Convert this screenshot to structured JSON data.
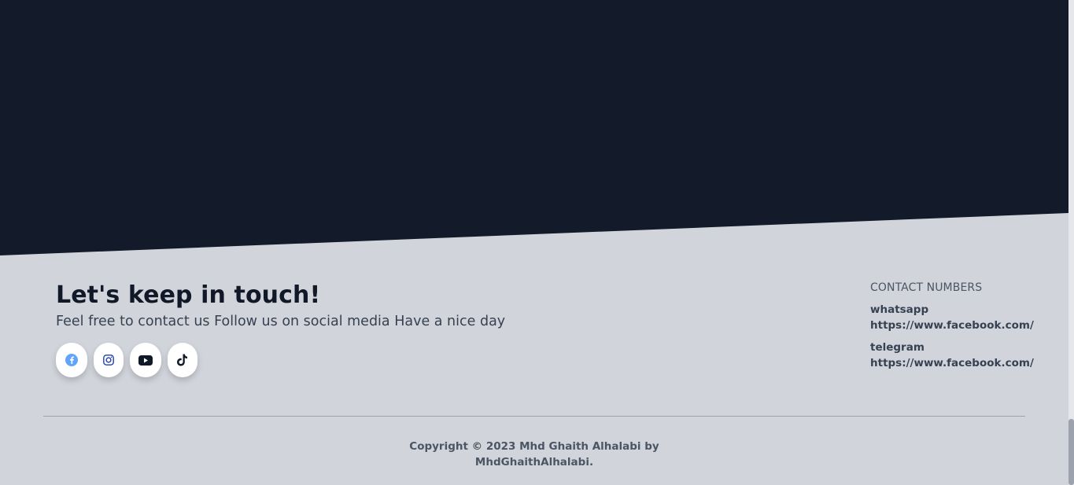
{
  "footer": {
    "title": "Let's keep in touch!",
    "subtitle": "Feel free to contact us Follow us on social media Have a nice day",
    "socials": [
      {
        "name": "facebook",
        "icon": "facebook-icon",
        "color": "#60a5fa"
      },
      {
        "name": "instagram",
        "icon": "instagram-icon",
        "color": "#1e40af"
      },
      {
        "name": "youtube",
        "icon": "youtube-icon",
        "color": "#111827"
      },
      {
        "name": "tiktok",
        "icon": "tiktok-icon",
        "color": "#111827"
      }
    ]
  },
  "contacts": {
    "heading": "CONTACT NUMBERS",
    "items": [
      {
        "label": "whatsapp",
        "url": "https://www.facebook.com/"
      },
      {
        "label": "telegram",
        "url": "https://www.facebook.com/"
      }
    ]
  },
  "copyright": {
    "line1": "Copyright © 2023 Mhd Ghaith Alhalabi by",
    "line2": "MhdGhaithAlhalabi."
  },
  "colors": {
    "dark_band": "#131a29",
    "footer_bg": "#d1d5db",
    "text_primary": "#111827",
    "text_secondary": "#374151"
  }
}
